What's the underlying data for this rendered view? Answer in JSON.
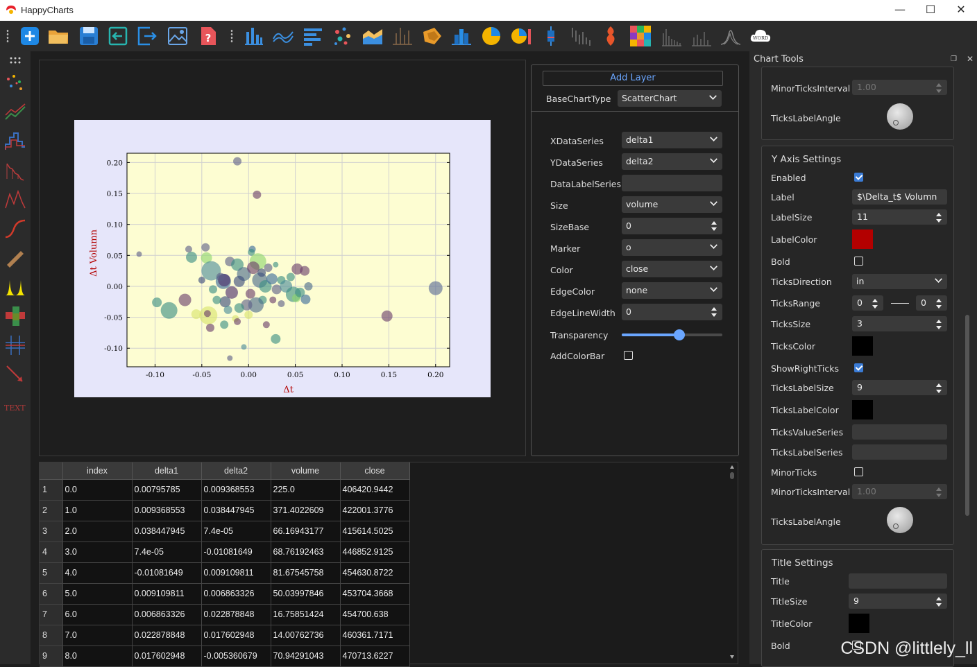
{
  "app": {
    "title": "HappyCharts"
  },
  "window_controls": {
    "minimize": "—",
    "maximize": "☐",
    "close": "✕"
  },
  "toolbar": {
    "file_tools": [
      "new-icon",
      "open-folder-icon",
      "save-icon",
      "import-icon",
      "export-icon",
      "image-icon",
      "help-icon"
    ],
    "chart_types": [
      "bar-chart-icon",
      "line-chart-icon",
      "horizontal-bar-icon",
      "scatter-icon",
      "area-chart-icon",
      "stem-chart-icon",
      "polygon-icon",
      "stacked-bar-icon",
      "pie-chart-icon",
      "pie-bar-icon",
      "box-icon",
      "candlestick-icon",
      "violin-icon",
      "heatmap-icon",
      "histogram-icon",
      "errorbar-icon",
      "density-icon",
      "wordcloud-icon"
    ],
    "wordcloud_text": "WORD"
  },
  "leftbar": {
    "more_icon": "grid-dots-icon",
    "items": [
      "scatter-tool-icon",
      "line-tool-icon",
      "step-tool-icon",
      "stem-tool-icon",
      "fill-tool-icon",
      "curve-tool-icon",
      "bar-tool-icon",
      "peak-tool-icon",
      "heatmap-tool-icon",
      "grid-tool-icon",
      "arrow-tool-icon"
    ],
    "text_item": "TEXT"
  },
  "chart_data": {
    "type": "scatter",
    "xlabel": "Δt",
    "ylabel": "Δt Volumn",
    "xlim": [
      -0.13,
      0.215
    ],
    "ylim": [
      -0.13,
      0.215
    ],
    "xticks": [
      "-0.10",
      "-0.05",
      "0.00",
      "0.05",
      "0.10",
      "0.15",
      "0.20"
    ],
    "yticks": [
      "-0.10",
      "-0.05",
      "0.00",
      "0.05",
      "0.10",
      "0.15",
      "0.20"
    ],
    "grid": true,
    "points": [
      {
        "x": -0.012,
        "y": 0.202,
        "s": 6,
        "c": "#5d5f88"
      },
      {
        "x": 0.009,
        "y": 0.148,
        "s": 6,
        "c": "#6b3f6a"
      },
      {
        "x": 0.2,
        "y": -0.003,
        "s": 10,
        "c": "#5b6a95"
      },
      {
        "x": 0.148,
        "y": -0.048,
        "s": 8,
        "c": "#6b3f6a"
      },
      {
        "x": -0.117,
        "y": 0.052,
        "s": 4,
        "c": "#5d5f88"
      },
      {
        "x": -0.085,
        "y": -0.039,
        "s": 12,
        "c": "#3a8e83"
      },
      {
        "x": -0.098,
        "y": -0.026,
        "s": 7,
        "c": "#3a8e83"
      },
      {
        "x": -0.068,
        "y": -0.022,
        "s": 9,
        "c": "#6b3f6a"
      },
      {
        "x": -0.046,
        "y": 0.063,
        "s": 6,
        "c": "#5d5f88"
      },
      {
        "x": -0.064,
        "y": 0.06,
        "s": 5,
        "c": "#5d5f88"
      },
      {
        "x": -0.061,
        "y": 0.047,
        "s": 8,
        "c": "#3a8e83"
      },
      {
        "x": -0.045,
        "y": 0.046,
        "s": 8,
        "c": "#8ed56d"
      },
      {
        "x": -0.04,
        "y": 0.025,
        "s": 14,
        "c": "#4a8a99"
      },
      {
        "x": -0.043,
        "y": -0.047,
        "s": 13,
        "c": "#d8e36a"
      },
      {
        "x": -0.056,
        "y": -0.045,
        "s": 7,
        "c": "#d8e36a"
      },
      {
        "x": -0.041,
        "y": -0.067,
        "s": 6,
        "c": "#6b3f6a"
      },
      {
        "x": -0.026,
        "y": -0.062,
        "s": 6,
        "c": "#3a8e83"
      },
      {
        "x": -0.044,
        "y": -0.044,
        "s": 5,
        "c": "#6b3f6a"
      },
      {
        "x": -0.027,
        "y": 0.008,
        "s": 11,
        "c": "#3a6b99"
      },
      {
        "x": -0.026,
        "y": 0.01,
        "s": 9,
        "c": "#4a2a6a"
      },
      {
        "x": -0.025,
        "y": -0.025,
        "s": 8,
        "c": "#3a4a7a"
      },
      {
        "x": -0.034,
        "y": -0.022,
        "s": 6,
        "c": "#3a8e83"
      },
      {
        "x": -0.02,
        "y": 0.04,
        "s": 7,
        "c": "#5d5f88"
      },
      {
        "x": -0.012,
        "y": 0.035,
        "s": 9,
        "c": "#3a8e83"
      },
      {
        "x": -0.005,
        "y": 0.02,
        "s": 10,
        "c": "#4a6a8a"
      },
      {
        "x": 0.004,
        "y": 0.06,
        "s": 5,
        "c": "#3a6b99"
      },
      {
        "x": 0.003,
        "y": 0.055,
        "s": 5,
        "c": "#3a8e83"
      },
      {
        "x": 0.01,
        "y": 0.04,
        "s": 12,
        "c": "#8ed56d"
      },
      {
        "x": 0.005,
        "y": 0.03,
        "s": 9,
        "c": "#6b3f6a"
      },
      {
        "x": 0.012,
        "y": 0.01,
        "s": 11,
        "c": "#4a6a8a"
      },
      {
        "x": 0.018,
        "y": 0.0,
        "s": 9,
        "c": "#3a8e83"
      },
      {
        "x": 0.021,
        "y": 0.03,
        "s": 6,
        "c": "#5d5f88"
      },
      {
        "x": 0.029,
        "y": 0.035,
        "s": 4,
        "c": "#3a8e83"
      },
      {
        "x": 0.025,
        "y": 0.012,
        "s": 8,
        "c": "#3a6b99"
      },
      {
        "x": 0.03,
        "y": -0.005,
        "s": 7,
        "c": "#5d5f88"
      },
      {
        "x": 0.035,
        "y": 0.01,
        "s": 6,
        "c": "#3a8e83"
      },
      {
        "x": 0.04,
        "y": 0.0,
        "s": 9,
        "c": "#4a8a99"
      },
      {
        "x": 0.048,
        "y": -0.013,
        "s": 11,
        "c": "#3a8e83"
      },
      {
        "x": 0.051,
        "y": -0.019,
        "s": 6,
        "c": "#8ed56d"
      },
      {
        "x": 0.055,
        "y": -0.01,
        "s": 7,
        "c": "#3a8e83"
      },
      {
        "x": 0.052,
        "y": 0.028,
        "s": 8,
        "c": "#6b3f6a"
      },
      {
        "x": 0.06,
        "y": 0.025,
        "s": 7,
        "c": "#6b3f6a"
      },
      {
        "x": 0.064,
        "y": 0.0,
        "s": 6,
        "c": "#4a6a8a"
      },
      {
        "x": 0.061,
        "y": -0.021,
        "s": 7,
        "c": "#3a6b99"
      },
      {
        "x": 0.015,
        "y": -0.022,
        "s": 6,
        "c": "#3a8e83"
      },
      {
        "x": 0.008,
        "y": -0.03,
        "s": 11,
        "c": "#4a6a8a"
      },
      {
        "x": -0.002,
        "y": -0.03,
        "s": 8,
        "c": "#5d5f88"
      },
      {
        "x": -0.01,
        "y": -0.035,
        "s": 7,
        "c": "#3a8e83"
      },
      {
        "x": -0.014,
        "y": -0.052,
        "s": 5,
        "c": "#d8e36a"
      },
      {
        "x": -0.012,
        "y": -0.057,
        "s": 5,
        "c": "#6b3f6a"
      },
      {
        "x": 0.0,
        "y": -0.046,
        "s": 6,
        "c": "#d8e36a"
      },
      {
        "x": 0.019,
        "y": -0.062,
        "s": 5,
        "c": "#6b3f6a"
      },
      {
        "x": 0.029,
        "y": -0.085,
        "s": 7,
        "c": "#3a8e83"
      },
      {
        "x": -0.005,
        "y": -0.098,
        "s": 4,
        "c": "#4a8a99"
      },
      {
        "x": -0.02,
        "y": -0.116,
        "s": 4,
        "c": "#5d5f88"
      },
      {
        "x": -0.01,
        "y": 0.008,
        "s": 8,
        "c": "#3a4a7a"
      },
      {
        "x": -0.03,
        "y": 0.015,
        "s": 6,
        "c": "#5d5f88"
      },
      {
        "x": -0.05,
        "y": 0.01,
        "s": 5,
        "c": "#3a4a7a"
      },
      {
        "x": 0.002,
        "y": -0.012,
        "s": 7,
        "c": "#6b3f6a"
      },
      {
        "x": -0.018,
        "y": -0.01,
        "s": 9,
        "c": "#4a2a6a"
      },
      {
        "x": 0.026,
        "y": -0.022,
        "s": 5,
        "c": "#6b3f6a"
      },
      {
        "x": 0.035,
        "y": -0.028,
        "s": 5,
        "c": "#5d5f88"
      },
      {
        "x": 0.045,
        "y": 0.015,
        "s": 6,
        "c": "#3a8e83"
      },
      {
        "x": 0.014,
        "y": 0.022,
        "s": 6,
        "c": "#3a4a7a"
      },
      {
        "x": -0.038,
        "y": -0.005,
        "s": 6,
        "c": "#3a8e83"
      },
      {
        "x": -0.022,
        "y": -0.038,
        "s": 6,
        "c": "#4a8a99"
      }
    ]
  },
  "config": {
    "add_layer_label": "Add Layer",
    "base_chart_type_label": "BaseChartType",
    "base_chart_type_value": "ScatterChart",
    "rows": [
      {
        "label": "XDataSeries",
        "value": "delta1",
        "kind": "combo"
      },
      {
        "label": "YDataSeries",
        "value": "delta2",
        "kind": "combo"
      },
      {
        "label": "DataLabelSeries",
        "value": "",
        "kind": "field"
      },
      {
        "label": "Size",
        "value": "volume",
        "kind": "combo"
      },
      {
        "label": "SizeBase",
        "value": "0",
        "kind": "spin"
      },
      {
        "label": "Marker",
        "value": "o",
        "kind": "combo"
      },
      {
        "label": "Color",
        "value": "close",
        "kind": "combo"
      },
      {
        "label": "EdgeColor",
        "value": "none",
        "kind": "combo"
      },
      {
        "label": "EdgeLineWidth",
        "value": "0",
        "kind": "spin"
      }
    ],
    "transparency_label": "Transparency",
    "transparency_value": 0.57,
    "add_colorbar_label": "AddColorBar"
  },
  "table": {
    "columns": [
      "index",
      "delta1",
      "delta2",
      "volume",
      "close"
    ],
    "rows": [
      [
        "1",
        "0.0",
        "0.00795785",
        "0.009368553",
        "225.0",
        "406420.9442"
      ],
      [
        "2",
        "1.0",
        "0.009368553",
        "0.038447945",
        "371.4022609",
        "422001.3776"
      ],
      [
        "3",
        "2.0",
        "0.038447945",
        "7.4e-05",
        "66.16943177",
        "415614.5025"
      ],
      [
        "4",
        "3.0",
        "7.4e-05",
        "-0.01081649",
        "68.76192463",
        "446852.9125"
      ],
      [
        "5",
        "4.0",
        "-0.01081649",
        "0.009109811",
        "81.67545758",
        "454630.8722"
      ],
      [
        "6",
        "5.0",
        "0.009109811",
        "0.006863326",
        "50.03997846",
        "453704.3668"
      ],
      [
        "7",
        "6.0",
        "0.006863326",
        "0.022878848",
        "16.75851424",
        "454700.638"
      ],
      [
        "8",
        "7.0",
        "0.022878848",
        "0.017602948",
        "14.00762736",
        "460361.7171"
      ],
      [
        "9",
        "8.0",
        "0.017602948",
        "-0.005360679",
        "70.94291043",
        "470713.6227"
      ]
    ]
  },
  "tools": {
    "title": "Chart Tools",
    "x_axis_tail": {
      "minor_ticks_interval_label": "MinorTicksInterval",
      "minor_ticks_interval_value": "1.00",
      "ticks_label_angle_label": "TicksLabelAngle"
    },
    "y_axis": {
      "title": "Y Axis Settings",
      "enabled_label": "Enabled",
      "enabled": true,
      "label_label": "Label",
      "label_value": "$\\Delta_t$ Volumn",
      "label_size_label": "LabelSize",
      "label_size_value": "11",
      "label_color_label": "LabelColor",
      "label_color": "#b30000",
      "bold_label": "Bold",
      "bold": false,
      "ticks_direction_label": "TicksDirection",
      "ticks_direction_value": "in",
      "ticks_range_label": "TicksRange",
      "ticks_range_min": "0",
      "ticks_range_max": "0",
      "ticks_size_label": "TicksSize",
      "ticks_size_value": "3",
      "ticks_color_label": "TicksColor",
      "ticks_color": "#000000",
      "show_right_ticks_label": "ShowRightTicks",
      "show_right_ticks": true,
      "ticks_label_size_label": "TicksLabelSize",
      "ticks_label_size_value": "9",
      "ticks_label_color_label": "TicksLabelColor",
      "ticks_label_color": "#000000",
      "ticks_value_series_label": "TicksValueSeries",
      "ticks_label_series_label": "TicksLabelSeries",
      "minor_ticks_label": "MinorTicks",
      "minor_ticks": false,
      "minor_ticks_interval_label": "MinorTicksInterval",
      "minor_ticks_interval_value": "1.00",
      "ticks_label_angle_label": "TicksLabelAngle"
    },
    "title_settings": {
      "title": "Title Settings",
      "title_label": "Title",
      "title_value": "",
      "title_size_label": "TitleSize",
      "title_size_value": "9",
      "title_color_label": "TitleColor",
      "title_color": "#000000",
      "bold_label": "Bold"
    }
  },
  "watermark": "CSDN @littlely_ll"
}
